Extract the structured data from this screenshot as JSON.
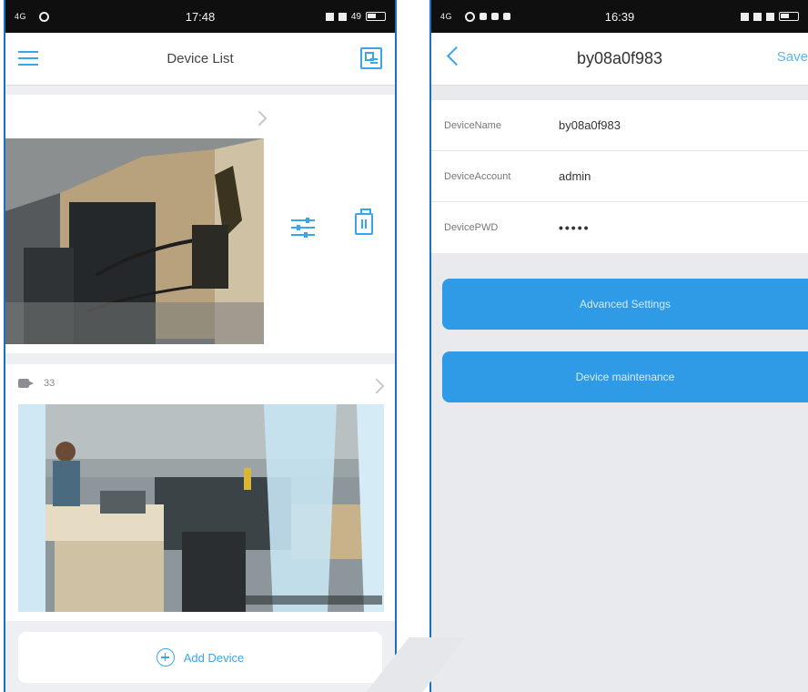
{
  "left": {
    "status": {
      "signal": "4G",
      "time": "17:48",
      "right": "49"
    },
    "title": "Device List",
    "device2": {
      "label": "33"
    },
    "add_device_label": "Add Device"
  },
  "right": {
    "status": {
      "signal": "4G",
      "time": "16:39"
    },
    "title": "by08a0f983",
    "save_label": "Save",
    "fields": [
      {
        "label": "DeviceName",
        "value": "by08a0f983"
      },
      {
        "label": "DeviceAccount",
        "value": "admin"
      },
      {
        "label": "DevicePWD",
        "value": "•••••"
      }
    ],
    "advanced_label": "Advanced Settings",
    "maintenance_label": "Device maintenance"
  },
  "colors": {
    "accent": "#3aa5e8",
    "button": "#2f9ae6",
    "statusbar": "#0f0f0f"
  },
  "icons": [
    "menu-icon",
    "qr-icon",
    "chevron-right-icon",
    "settings-sliders-icon",
    "trash-icon",
    "camera-icon",
    "plus-circle-icon",
    "back-chevron-icon"
  ]
}
